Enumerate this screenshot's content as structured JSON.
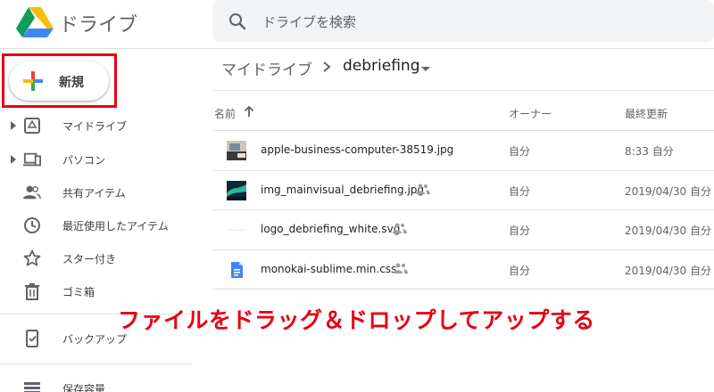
{
  "app": {
    "title": "ドライブ",
    "logo": "google-drive-logo"
  },
  "search": {
    "placeholder": "ドライブを検索",
    "icon": "search-icon"
  },
  "new_button": {
    "label": "新規",
    "icon": "plus-icon",
    "highlight_color": "#e60012"
  },
  "sidebar": {
    "items": [
      {
        "label": "マイドライブ",
        "icon": "my-drive-icon",
        "expandable": true
      },
      {
        "label": "パソコン",
        "icon": "computers-icon",
        "expandable": true
      },
      {
        "label": "共有アイテム",
        "icon": "people-icon",
        "expandable": false
      },
      {
        "label": "最近使用したアイテム",
        "icon": "clock-icon",
        "expandable": false
      },
      {
        "label": "スター付き",
        "icon": "star-icon",
        "expandable": false
      },
      {
        "label": "ゴミ箱",
        "icon": "trash-icon",
        "expandable": false
      },
      {
        "label": "バックアップ",
        "icon": "backup-icon",
        "expandable": false
      },
      {
        "label": "保存容量",
        "icon": "storage-icon",
        "expandable": false
      }
    ]
  },
  "breadcrumb": {
    "root": "マイドライブ",
    "current": "debriefing"
  },
  "table": {
    "columns": {
      "name": "名前",
      "owner": "オーナー",
      "modified": "最終更新"
    },
    "rows": [
      {
        "name": "apple-business-computer-38519.jpg",
        "owner": "自分",
        "modified": "8:33 自分",
        "shared": false,
        "type": "photo"
      },
      {
        "name": "img_mainvisual_debriefing.jpg",
        "owner": "自分",
        "modified": "2019/04/30 自分",
        "shared": true,
        "type": "photo-aurora"
      },
      {
        "name": "logo_debriefing_white.svg",
        "owner": "自分",
        "modified": "2019/04/30 自分",
        "shared": true,
        "type": "svg-blank"
      },
      {
        "name": "monokai-sublime.min.css",
        "owner": "自分",
        "modified": "2019/04/30 自分",
        "shared": true,
        "type": "doc"
      }
    ]
  },
  "overlay_text": "ファイルをドラッグ＆ドロップしてアップする",
  "colors": {
    "accent_red": "#e60012",
    "doc_blue": "#4285f4",
    "text_gray": "#5f6368"
  }
}
